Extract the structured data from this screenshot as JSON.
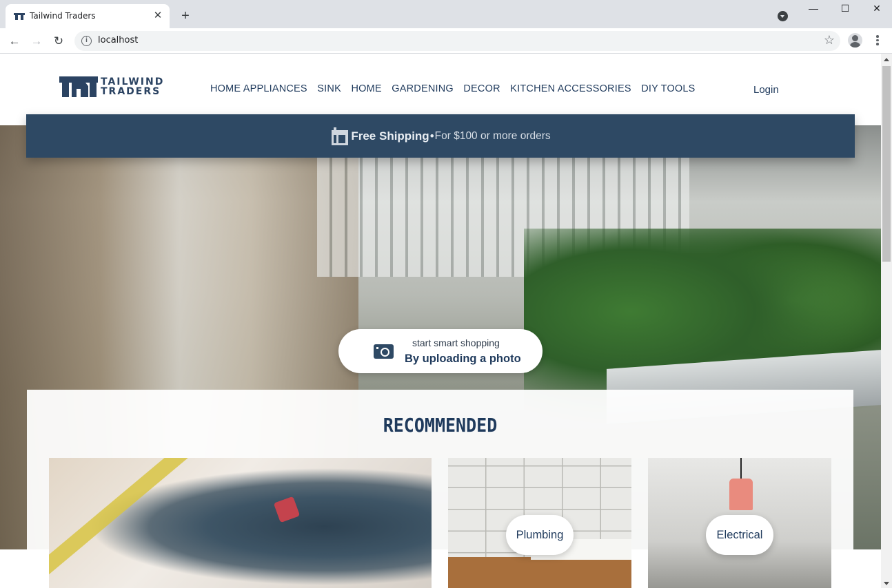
{
  "browser": {
    "tab_title": "Tailwind Traders",
    "tab_close": "✕",
    "new_tab": "+",
    "url": "localhost",
    "info_glyph": "i",
    "star_glyph": "☆",
    "back_glyph": "←",
    "forward_glyph": "→",
    "reload_glyph": "↻",
    "minimize_glyph": "—",
    "maximize_glyph": "☐",
    "close_glyph": "✕"
  },
  "site": {
    "logo_line1": "TAILWIND",
    "logo_line2": "TRADERS",
    "nav": [
      "HOME APPLIANCES",
      "SINK",
      "HOME",
      "GARDENING",
      "DECOR",
      "KITCHEN ACCESSORIES",
      "DIY TOOLS"
    ],
    "login": "Login",
    "brand_color": "#2e4964"
  },
  "shipping": {
    "strong": "Free Shipping",
    "separator": "•",
    "rest": "For $100 or more orders"
  },
  "upload": {
    "small": "start smart shopping",
    "big": "By uploading a photo",
    "icon": "camera-icon"
  },
  "recommended": {
    "title": "RECOMMENDED",
    "cards": [
      {
        "label": ""
      },
      {
        "label": "Plumbing"
      },
      {
        "label": "Electrical"
      }
    ]
  }
}
